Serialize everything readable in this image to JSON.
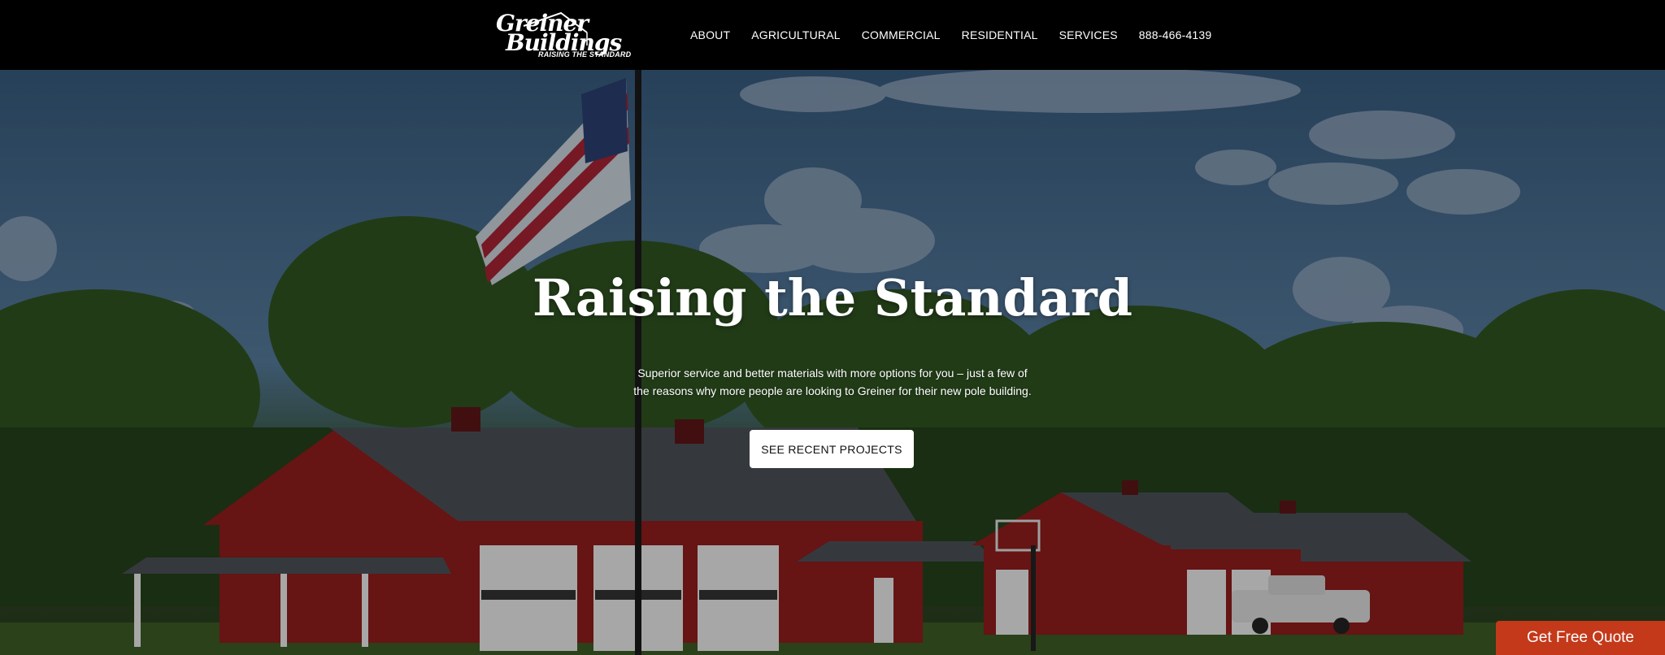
{
  "header": {
    "logo": {
      "line1": "Greiner",
      "line2": "Buildings",
      "tagline": "RAISING THE STANDARD"
    },
    "nav": [
      {
        "label": "ABOUT"
      },
      {
        "label": "AGRICULTURAL"
      },
      {
        "label": "COMMERCIAL"
      },
      {
        "label": "RESIDENTIAL"
      },
      {
        "label": "SERVICES"
      },
      {
        "label": "888-466-4139"
      }
    ]
  },
  "hero": {
    "title": "Raising the Standard",
    "subtitle": "Superior service and better materials with more options for you – just a few of the reasons why more people are looking to Greiner for their new pole building.",
    "cta_label": "SEE RECENT PROJECTS"
  },
  "quote_button": {
    "label": "Get Free Quote"
  },
  "colors": {
    "header_bg": "#000000",
    "quote_button_bg": "#c4391a",
    "barn_red": "#8e1c1c"
  },
  "icons": [
    "american-flag",
    "basketball-hoop"
  ]
}
